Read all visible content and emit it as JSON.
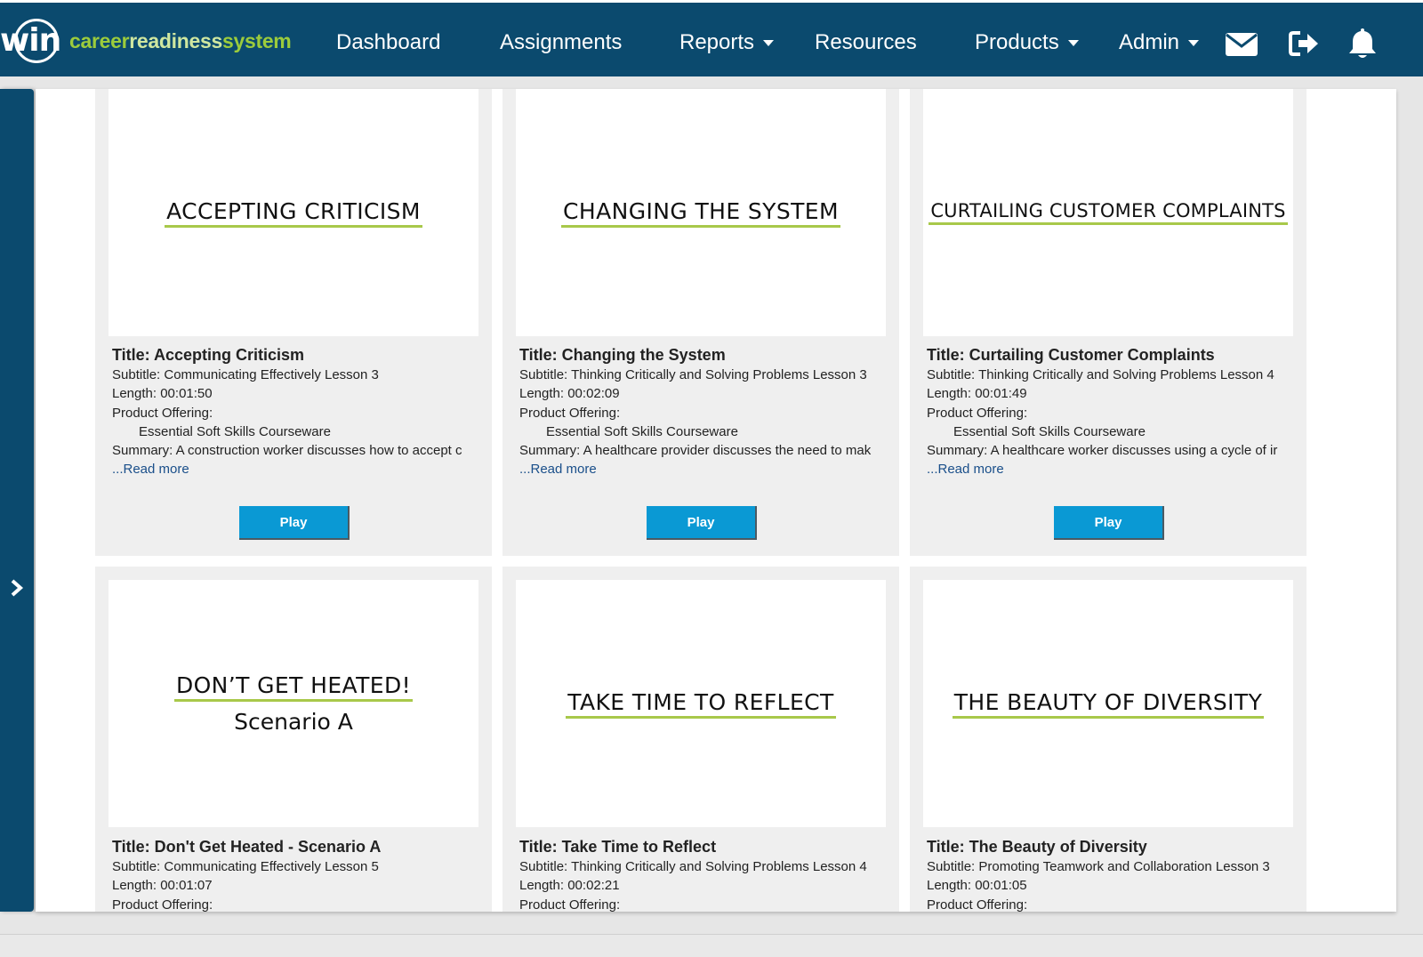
{
  "brand": {
    "mark": "win",
    "name_part1": "career",
    "name_part2": "readiness",
    "name_part3": "system"
  },
  "colors": {
    "navbar": "#0b4a6e",
    "accent_green": "#9ccc3c",
    "play_button": "#0a99d4",
    "link": "#1a4f8a"
  },
  "nav": {
    "dashboard": "Dashboard",
    "assignments": "Assignments",
    "reports": "Reports",
    "resources": "Resources",
    "products": "Products",
    "admin": "Admin",
    "icons": [
      "envelope-icon",
      "sign-out-icon",
      "bell-icon"
    ]
  },
  "labels": {
    "play": "Play",
    "read_more": "...Read more"
  },
  "cards": [
    {
      "thumb_title": "ACCEPTING CRITICISM",
      "thumb_sub": "",
      "title": "Title: Accepting Criticism",
      "subtitle": "Subtitle: Communicating Effectively Lesson 3",
      "length": "Length: 00:01:50",
      "offering_label": "Product Offering:",
      "offering": "Essential Soft Skills Courseware",
      "summary": "Summary: A construction worker discusses how to accept c"
    },
    {
      "thumb_title": "CHANGING THE SYSTEM",
      "thumb_sub": "",
      "title": "Title: Changing the System",
      "subtitle": "Subtitle: Thinking Critically and Solving Problems Lesson 3",
      "length": "Length: 00:02:09",
      "offering_label": "Product Offering:",
      "offering": "Essential Soft Skills Courseware",
      "summary": "Summary: A healthcare provider discusses the need to mak"
    },
    {
      "thumb_title": "CURTAILING CUSTOMER COMPLAINTS",
      "thumb_sub": "",
      "title": "Title: Curtailing Customer Complaints",
      "subtitle": "Subtitle: Thinking Critically and Solving Problems Lesson 4",
      "length": "Length: 00:01:49",
      "offering_label": "Product Offering:",
      "offering": "Essential Soft Skills Courseware",
      "summary": "Summary: A healthcare worker discusses using a cycle of ir"
    },
    {
      "thumb_title": "DON’T GET HEATED!",
      "thumb_sub": "Scenario A",
      "title": "Title: Don't Get Heated - Scenario A",
      "subtitle": "Subtitle: Communicating Effectively Lesson 5",
      "length": "Length: 00:01:07",
      "offering_label": "Product Offering:"
    },
    {
      "thumb_title": "TAKE TIME TO REFLECT",
      "thumb_sub": "",
      "title": "Title: Take Time to Reflect",
      "subtitle": "Subtitle: Thinking Critically and Solving Problems Lesson 4",
      "length": "Length: 00:02:21",
      "offering_label": "Product Offering:"
    },
    {
      "thumb_title": "THE BEAUTY OF DIVERSITY",
      "thumb_sub": "",
      "title": "Title: The Beauty of Diversity",
      "subtitle": "Subtitle: Promoting Teamwork and Collaboration Lesson 3",
      "length": "Length: 00:01:05",
      "offering_label": "Product Offering:"
    }
  ]
}
